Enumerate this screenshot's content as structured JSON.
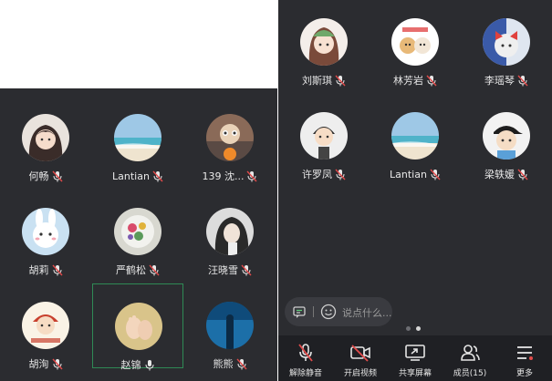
{
  "left_grid": [
    {
      "name": "何畅",
      "avatar": "anime-girl-avatar",
      "mic": "muted"
    },
    {
      "name": "Lantian",
      "avatar": "beach-avatar",
      "mic": "muted"
    },
    {
      "name": "139 沈...",
      "avatar": "cartoon-photo-avatar",
      "mic": "muted"
    },
    {
      "name": "胡莉",
      "avatar": "bunny-avatar",
      "mic": "muted"
    },
    {
      "name": "严鹤松",
      "avatar": "flower-crystal-avatar",
      "mic": "muted"
    },
    {
      "name": "汪晓雪",
      "avatar": "girl-photo-avatar",
      "mic": "muted"
    },
    {
      "name": "胡洵",
      "avatar": "cartoon-kid-avatar",
      "mic": "muted"
    },
    {
      "name": "赵锦",
      "avatar": "baby-feet-avatar",
      "mic": "on"
    },
    {
      "name": "熊熊",
      "avatar": "blue-silhouette-avatar",
      "mic": "muted"
    }
  ],
  "right_grid": [
    {
      "name": "刘斯琪",
      "avatar": "anime-girl-green-avatar",
      "mic": "muted"
    },
    {
      "name": "林芳岩",
      "avatar": "shiba-dogs-avatar",
      "mic": "muted"
    },
    {
      "name": "李瑶琴",
      "avatar": "cat-bow-avatar",
      "mic": "muted"
    },
    {
      "name": "许罗凤",
      "avatar": "cartoon-boy-avatar",
      "mic": "muted"
    },
    {
      "name": "Lantian",
      "avatar": "beach-avatar",
      "mic": "muted"
    },
    {
      "name": "梁轶媛",
      "avatar": "cartoon-cap-avatar",
      "mic": "muted"
    }
  ],
  "chat": {
    "placeholder": "说点什么..."
  },
  "pager": {
    "pages": 2,
    "current": 2
  },
  "toolbar": {
    "unmute": "解除静音",
    "video": "开启视频",
    "share": "共享屏幕",
    "members": "成员(15)",
    "more": "更多"
  },
  "colors": {
    "panel": "#2b2c30",
    "toolbar": "#1f2024",
    "active_border": "#2f8a55",
    "mute_red": "#e24b4b"
  }
}
